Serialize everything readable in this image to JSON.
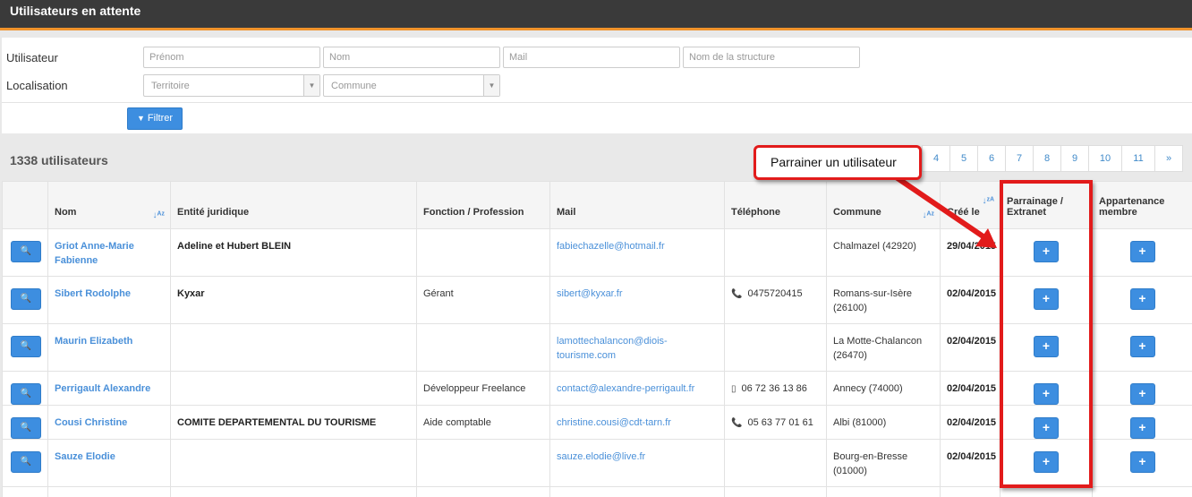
{
  "header": {
    "title": "Utilisateurs en attente"
  },
  "filters": {
    "user_label": "Utilisateur",
    "location_label": "Localisation",
    "prenom_placeholder": "Prénom",
    "nom_placeholder": "Nom",
    "mail_placeholder": "Mail",
    "structure_placeholder": "Nom de la structure",
    "territoire_placeholder": "Territoire",
    "commune_placeholder": "Commune",
    "filter_button": "Filtrer"
  },
  "summary": {
    "count": "1338 utilisateurs"
  },
  "pagination": [
    "4",
    "5",
    "6",
    "7",
    "8",
    "9",
    "10",
    "11",
    "»"
  ],
  "annotation": {
    "callout": "Parrainer un utilisateur",
    "color": "#e21b1b"
  },
  "table": {
    "headers": {
      "nom": "Nom",
      "entite": "Entité juridique",
      "fonction": "Fonction / Profession",
      "mail": "Mail",
      "telephone": "Téléphone",
      "commune": "Commune",
      "cree": "Créé le",
      "parrainage": "Parrainage / Extranet",
      "appartenance": "Appartenance membre"
    },
    "rows": [
      {
        "nom": "Griot Anne-Marie Fabienne",
        "entite": "Adeline et Hubert BLEIN",
        "fonction": "",
        "mail": "fabiechazelle@hotmail.fr",
        "phone_icon": "",
        "telephone": "",
        "commune": "Chalmazel (42920)",
        "date": "29/04/2015"
      },
      {
        "nom": "Sibert Rodolphe",
        "entite": "Kyxar",
        "fonction": "Gérant",
        "mail": "sibert@kyxar.fr",
        "phone_icon": "phone-icon",
        "telephone": "0475720415",
        "commune": "Romans-sur-Isère (26100)",
        "date": "02/04/2015"
      },
      {
        "nom": "Maurin Elizabeth",
        "entite": "",
        "fonction": "",
        "mail": "lamottechalancon@diois-tourisme.com",
        "phone_icon": "",
        "telephone": "",
        "commune": "La Motte-Chalancon (26470)",
        "date": "02/04/2015"
      },
      {
        "nom": "Perrigault Alexandre",
        "entite": "",
        "fonction": "Développeur Freelance",
        "mail": "contact@alexandre-perrigault.fr",
        "phone_icon": "mobile-icon",
        "telephone": "06 72 36 13 86",
        "commune": "Annecy (74000)",
        "date": "02/04/2015"
      },
      {
        "nom": "Cousi Christine",
        "entite": "COMITE DEPARTEMENTAL DU TOURISME",
        "fonction": "Aide comptable",
        "mail": "christine.cousi@cdt-tarn.fr",
        "phone_icon": "phone-icon",
        "telephone": "05 63 77 01 61",
        "commune": "Albi (81000)",
        "date": "02/04/2015"
      },
      {
        "nom": "Sauze Elodie",
        "entite": "",
        "fonction": "",
        "mail": "sauze.elodie@live.fr",
        "phone_icon": "",
        "telephone": "",
        "commune": "Bourg-en-Bresse (01000)",
        "date": "02/04/2015"
      }
    ]
  }
}
